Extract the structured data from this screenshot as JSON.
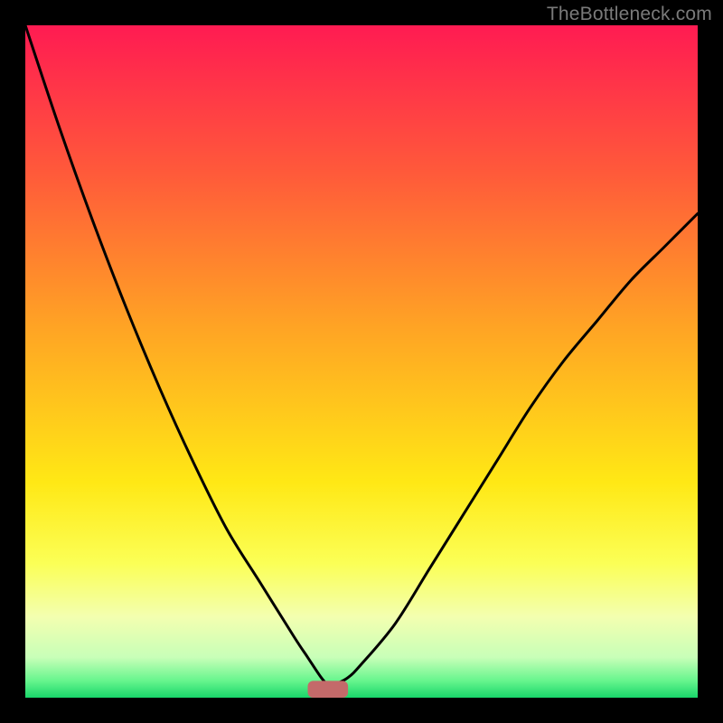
{
  "watermark": "TheBottleneck.com",
  "chart_data": {
    "type": "line",
    "title": "",
    "xlabel": "",
    "ylabel": "",
    "xlim": [
      0,
      100
    ],
    "ylim": [
      0,
      100
    ],
    "series": [
      {
        "name": "curve",
        "x": [
          0,
          5,
          10,
          15,
          20,
          25,
          30,
          35,
          40,
          42,
          44,
          45,
          46,
          48,
          50,
          55,
          60,
          65,
          70,
          75,
          80,
          85,
          90,
          95,
          100
        ],
        "values": [
          100,
          85,
          71,
          58,
          46,
          35,
          25,
          17,
          9,
          6,
          3,
          2,
          2,
          3,
          5,
          11,
          19,
          27,
          35,
          43,
          50,
          56,
          62,
          67,
          72
        ]
      }
    ],
    "marker": {
      "x": 45,
      "width": 6,
      "height": 2.5,
      "color": "#c46a6a"
    },
    "gradient_stops": [
      {
        "offset": 0.0,
        "color": "#ff1b52"
      },
      {
        "offset": 0.22,
        "color": "#ff5a3a"
      },
      {
        "offset": 0.45,
        "color": "#ffa424"
      },
      {
        "offset": 0.68,
        "color": "#ffe815"
      },
      {
        "offset": 0.8,
        "color": "#fbff56"
      },
      {
        "offset": 0.88,
        "color": "#f3ffb0"
      },
      {
        "offset": 0.94,
        "color": "#c8ffb8"
      },
      {
        "offset": 0.975,
        "color": "#66f58d"
      },
      {
        "offset": 1.0,
        "color": "#19d66a"
      }
    ]
  }
}
